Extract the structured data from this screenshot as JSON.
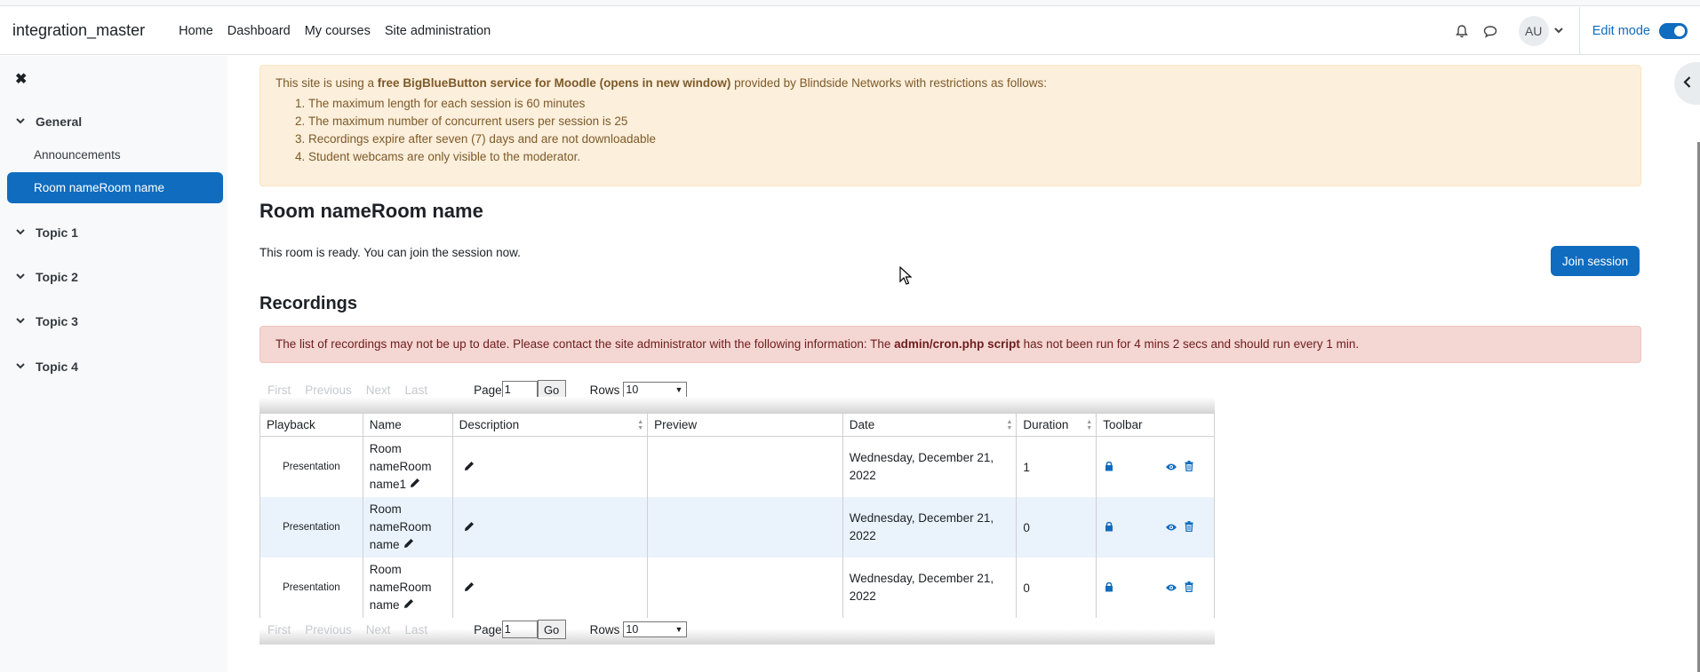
{
  "navbar": {
    "brand": "integration_master",
    "links": [
      "Home",
      "Dashboard",
      "My courses",
      "Site administration"
    ],
    "avatar_initials": "AU",
    "edit_mode_label": "Edit mode",
    "edit_mode_on": true
  },
  "drawer": {
    "close_icon": "close-icon",
    "sections": [
      "General",
      "Topic 1",
      "Topic 2",
      "Topic 3",
      "Topic 4"
    ],
    "general_items": [
      "Announcements",
      "Room nameRoom name"
    ],
    "active_item": "Room nameRoom name"
  },
  "notice": {
    "intro_pre": "This site is using a ",
    "intro_bold": "free BigBlueButton service for Moodle (opens in new window)",
    "intro_post": " provided by Blindside Networks with restrictions as follows:",
    "items": [
      "The maximum length for each session is 60 minutes",
      "The maximum number of concurrent users per session is 25",
      "Recordings expire after seven (7) days and are not downloadable",
      "Student webcams are only visible to the moderator."
    ]
  },
  "room": {
    "title": "Room nameRoom name",
    "status": "This room is ready. You can join the session now.",
    "join_label": "Join session"
  },
  "recordings": {
    "heading": "Recordings",
    "warning_pre": "The list of recordings may not be up to date. Please contact the site administrator with the following information: The ",
    "warning_bold": "admin/cron.php script",
    "warning_post": " has not been run for 4 mins 2 secs and should run every 1 min.",
    "pager": {
      "first": "First",
      "previous": "Previous",
      "next": "Next",
      "last": "Last",
      "page_label": "Page",
      "page_value": "1",
      "go": "Go",
      "rows_label": "Rows",
      "rows_value": "10"
    },
    "columns": [
      "Playback",
      "Name",
      "Description",
      "Preview",
      "Date",
      "Duration",
      "Toolbar"
    ],
    "rows": [
      {
        "playback": "Presentation",
        "name": "Room nameRoom name1",
        "date": "Wednesday, December 21, 2022",
        "duration": "1"
      },
      {
        "playback": "Presentation",
        "name": "Room nameRoom name",
        "date": "Wednesday, December 21, 2022",
        "duration": "0"
      },
      {
        "playback": "Presentation",
        "name": "Room nameRoom name",
        "date": "Wednesday, December 21, 2022",
        "duration": "0"
      }
    ]
  },
  "colors": {
    "accent": "#0f6cbf",
    "warning_bg": "#fcefdc",
    "danger_bg": "#f4d6d2",
    "alt_row": "#eaf3fc"
  }
}
